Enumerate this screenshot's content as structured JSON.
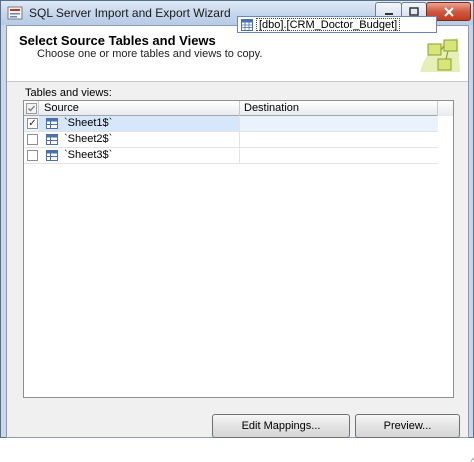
{
  "window": {
    "title": "SQL Server Import and Export Wizard"
  },
  "header": {
    "title": "Select Source Tables and Views",
    "subtitle": "Choose one or more tables and views to copy."
  },
  "tables_label": "Tables and views:",
  "grid": {
    "columns": {
      "source": "Source",
      "destination": "Destination"
    },
    "rows": [
      {
        "checked": true,
        "source": "`Sheet1$`",
        "destination": "[dbo].[CRM_Doctor_Budget]"
      },
      {
        "checked": false,
        "source": "`Sheet2$`",
        "destination": ""
      },
      {
        "checked": false,
        "source": "`Sheet3$`",
        "destination": ""
      }
    ]
  },
  "buttons": {
    "edit_mappings": "Edit Mappings...",
    "preview": "Preview..."
  },
  "colors": {
    "close_button": "#c23b1f",
    "titlebar": "#c4d6ec",
    "selection": "#d6e7fb"
  }
}
